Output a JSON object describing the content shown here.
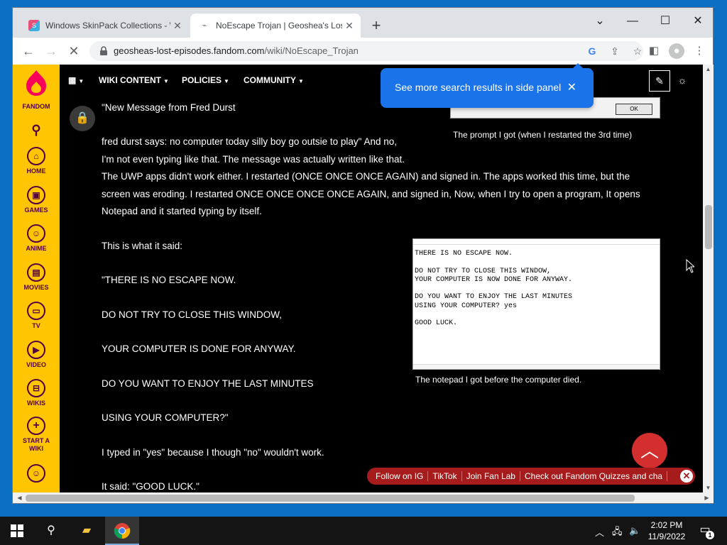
{
  "browser": {
    "tabs": [
      {
        "title": "Windows SkinPack Collections - W",
        "favicon": "skinpack-favicon",
        "active": false
      },
      {
        "title": "NoEscape Trojan | Geoshea's Lost",
        "favicon": "loading-spinner",
        "active": true
      }
    ],
    "url_domain": "geosheas-lost-episodes.fandom.com",
    "url_path": "/wiki/NoEscape_Trojan"
  },
  "sidebar": {
    "brand": "FANDOM",
    "items": [
      {
        "label": "HOME",
        "icon": "home-icon"
      },
      {
        "label": "GAMES",
        "icon": "games-icon"
      },
      {
        "label": "ANIME",
        "icon": "anime-icon"
      },
      {
        "label": "MOVIES",
        "icon": "movies-icon"
      },
      {
        "label": "TV",
        "icon": "tv-icon"
      },
      {
        "label": "VIDEO",
        "icon": "video-icon"
      },
      {
        "label": "WIKIS",
        "icon": "wikis-icon"
      },
      {
        "label": "START A WIKI",
        "icon": "plus-icon"
      }
    ]
  },
  "topnav": {
    "items": [
      "WIKI CONTENT",
      "POLICIES",
      "COMMUNITY"
    ]
  },
  "search_popup": {
    "message": "See more search results in side panel"
  },
  "article": {
    "lines": [
      "\"New Message from Fred Durst",
      "fred durst says: no computer today silly boy go outsie to play\" And no,",
      "I'm not even typing like that. The message was actually written like that.",
      "The UWP apps didn't work either. I restarted (ONCE ONCE ONCE AGAIN) and signed in. The apps worked this time, but the",
      "screen was eroding. I restarted ONCE ONCE ONCE ONCE AGAIN, and signed in, Now, when I try to open a program, It opens",
      "Notepad and it started typing by itself.",
      "This is what it said:",
      "\"THERE IS NO ESCAPE NOW.",
      "DO NOT TRY TO CLOSE THIS WINDOW,",
      "YOUR COMPUTER IS DONE FOR ANYWAY.",
      "DO YOU WANT TO ENJOY THE LAST MINUTES",
      "USING YOUR COMPUTER?\"",
      "I typed in \"yes\" because I though \"no\" wouldn't work.",
      "It said: \"GOOD LUCK.\""
    ],
    "caption_prompt": "The prompt I got (when I restarted the 3rd time)",
    "caption_notepad": "The notepad I got before the computer died.",
    "prompt_ok": "OK",
    "notepad_text": "THERE IS NO ESCAPE NOW.\n\nDO NOT TRY TO CLOSE THIS WINDOW,\nYOUR COMPUTER IS NOW DONE FOR ANYWAY.\n\nDO YOU WANT TO ENJOY THE LAST MINUTES\nUSING YOUR COMPUTER? yes\n\nGOOD LUCK."
  },
  "bottom_bar": {
    "items": [
      "Follow on IG",
      "TikTok",
      "Join Fan Lab",
      "Check out Fandom Quizzes and cha"
    ]
  },
  "taskbar": {
    "time": "2:02 PM",
    "date": "11/9/2022",
    "notification_count": "1"
  },
  "colors": {
    "fandom_yellow": "#ffc500",
    "fandom_purple": "#520044",
    "chrome_blue": "#1a73e8",
    "bottom_bar_red": "#a61c1c",
    "desktop_blue": "#0a6fc2"
  }
}
